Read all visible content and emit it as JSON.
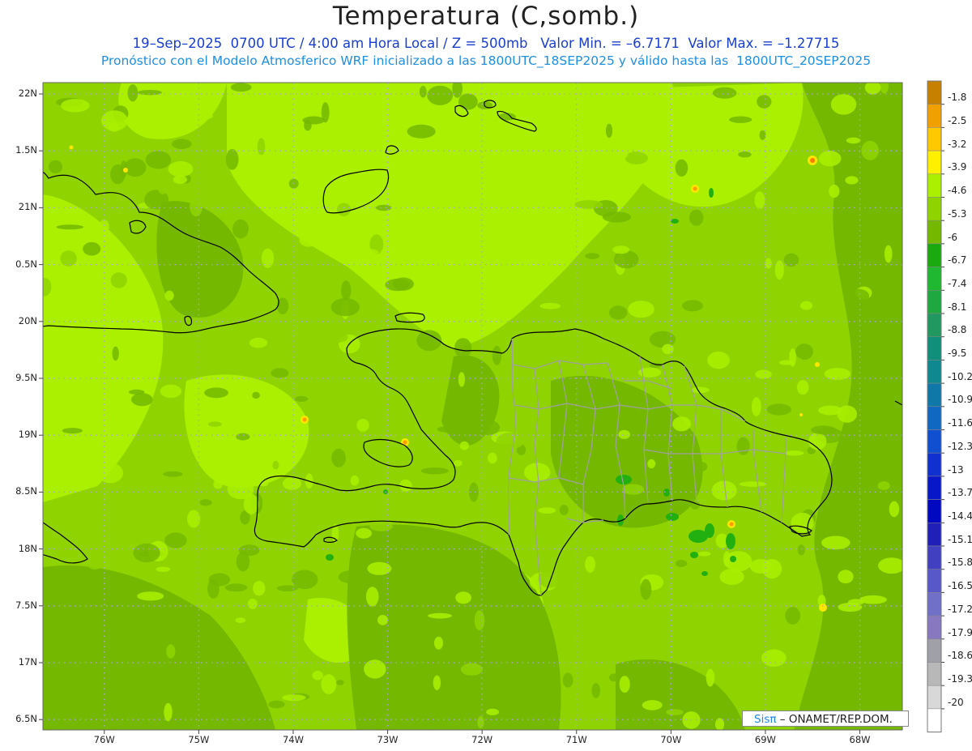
{
  "title": "Temperatura (C,somb.)",
  "subtitle1": "19–Sep–2025  0700 UTC / 4:00 am Hora Local / Z = 500mb   Valor Min. = –6.7171  Valor Max. = –1.27715",
  "subtitle2": "Pronóstico con el Modelo Atmosferico WRF inicializado a las 1800UTC_18SEP2025 y válido hasta las  1800UTC_20SEP2025",
  "credit": {
    "logo": "Sisπ",
    "text": "– ONAMET/REP.DOM."
  },
  "map": {
    "lon_range": [
      -76.65,
      -67.55
    ],
    "lat_range": [
      6.35,
      22.1
    ],
    "lat_ticks": [
      {
        "value": 22,
        "label": "22N"
      },
      {
        "value": 21.5,
        "label": "1.5N"
      },
      {
        "value": 21,
        "label": "21N"
      },
      {
        "value": 20.5,
        "label": "0.5N"
      },
      {
        "value": 20,
        "label": "20N"
      },
      {
        "value": 19.5,
        "label": "9.5N"
      },
      {
        "value": 19,
        "label": "19N"
      },
      {
        "value": 18.5,
        "label": "8.5N"
      },
      {
        "value": 18,
        "label": "18N"
      },
      {
        "value": 17.5,
        "label": "7.5N"
      },
      {
        "value": 17,
        "label": "17N"
      },
      {
        "value": 16.5,
        "label": "6.5N"
      }
    ],
    "lon_ticks": [
      {
        "value": -76,
        "label": "76W"
      },
      {
        "value": -75,
        "label": "75W"
      },
      {
        "value": -74,
        "label": "74W"
      },
      {
        "value": -73,
        "label": "73W"
      },
      {
        "value": -72,
        "label": "72W"
      },
      {
        "value": -71,
        "label": "71W"
      },
      {
        "value": -70,
        "label": "70W"
      },
      {
        "value": -69,
        "label": "69W"
      },
      {
        "value": -68,
        "label": "68W"
      }
    ],
    "base_color": "#8fd400",
    "colors": {
      "light": "#aaf000",
      "mid": "#8fd400",
      "dark": "#74b800",
      "green": "#22b010",
      "yellow": "#ffe600",
      "orange": "#ff9d00",
      "coast": "#000000",
      "provinces": "#a0a0a0"
    }
  },
  "colorbar": {
    "levels": [
      {
        "label": "-1.8",
        "color": "#c88000"
      },
      {
        "label": "-2.5",
        "color": "#f0a000"
      },
      {
        "label": "-3.2",
        "color": "#ffc800"
      },
      {
        "label": "-3.9",
        "color": "#fff000"
      },
      {
        "label": "-4.6",
        "color": "#aaf000"
      },
      {
        "label": "-5.3",
        "color": "#8fd400"
      },
      {
        "label": "-6",
        "color": "#74b800"
      },
      {
        "label": "-6.7",
        "color": "#1aaa10"
      },
      {
        "label": "-7.4",
        "color": "#20b830"
      },
      {
        "label": "-8.1",
        "color": "#20a840"
      },
      {
        "label": "-8.8",
        "color": "#209860"
      },
      {
        "label": "-9.5",
        "color": "#10907a"
      },
      {
        "label": "-10.2",
        "color": "#108890"
      },
      {
        "label": "-10.9",
        "color": "#1078a8"
      },
      {
        "label": "-11.6",
        "color": "#1068c0"
      },
      {
        "label": "-12.3",
        "color": "#1050d0"
      },
      {
        "label": "-13",
        "color": "#1030d0"
      },
      {
        "label": "-13.7",
        "color": "#0818c8"
      },
      {
        "label": "-14.4",
        "color": "#0008c0"
      },
      {
        "label": "-15.1",
        "color": "#2020b8"
      },
      {
        "label": "-15.8",
        "color": "#4040c0"
      },
      {
        "label": "-16.5",
        "color": "#5858c8"
      },
      {
        "label": "-17.2",
        "color": "#7070c8"
      },
      {
        "label": "-17.9",
        "color": "#8878c0"
      },
      {
        "label": "-18.6",
        "color": "#a0a0a8"
      },
      {
        "label": "-19.3",
        "color": "#b8b8b8"
      },
      {
        "label": "-20",
        "color": "#d8d8d8"
      },
      {
        "label": "",
        "color": "#ffffff"
      }
    ]
  }
}
